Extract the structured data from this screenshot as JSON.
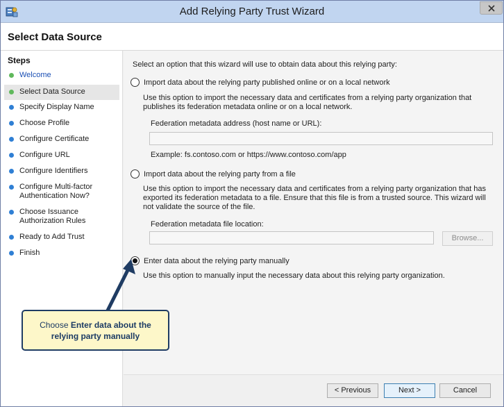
{
  "window": {
    "title": "Add Relying Party Trust Wizard",
    "close_icon": "close-icon",
    "app_icon": "wizard-app-icon"
  },
  "header": {
    "title": "Select Data Source"
  },
  "steps": {
    "heading": "Steps",
    "items": [
      {
        "label": "Welcome",
        "state": "completed-link"
      },
      {
        "label": "Select Data Source",
        "state": "current"
      },
      {
        "label": "Specify Display Name",
        "state": "pending"
      },
      {
        "label": "Choose Profile",
        "state": "pending"
      },
      {
        "label": "Configure Certificate",
        "state": "pending"
      },
      {
        "label": "Configure URL",
        "state": "pending"
      },
      {
        "label": "Configure Identifiers",
        "state": "pending"
      },
      {
        "label": "Configure Multi-factor Authentication Now?",
        "state": "pending"
      },
      {
        "label": "Choose Issuance Authorization Rules",
        "state": "pending"
      },
      {
        "label": "Ready to Add Trust",
        "state": "pending"
      },
      {
        "label": "Finish",
        "state": "pending"
      }
    ]
  },
  "main": {
    "intro": "Select an option that this wizard will use to obtain data about this relying party:",
    "option_online": {
      "label": "Import data about the relying party published online or on a local network",
      "description": "Use this option to import the necessary data and certificates from a relying party organization that publishes its federation metadata online or on a local network.",
      "field_label": "Federation metadata address (host name or URL):",
      "field_value": "",
      "example": "Example: fs.contoso.com or https://www.contoso.com/app",
      "selected": false
    },
    "option_file": {
      "label": "Import data about the relying party from a file",
      "description": "Use this option to import the necessary data and certificates from a relying party organization that has exported its federation metadata to a file. Ensure that this file is from a trusted source.  This wizard will not validate the source of the file.",
      "field_label": "Federation metadata file location:",
      "field_value": "",
      "browse_label": "Browse...",
      "selected": false
    },
    "option_manual": {
      "label": "Enter data about the relying party manually",
      "description": "Use this option to manually input the necessary data about this relying party organization.",
      "selected": true
    }
  },
  "footer": {
    "previous_label": "< Previous",
    "next_label": "Next >",
    "cancel_label": "Cancel"
  },
  "callout": {
    "prefix": "Choose ",
    "emphasis": "Enter data about the relying party manually"
  },
  "colors": {
    "completed_dot": "#5fb85c",
    "pending_dot": "#2f7fd4",
    "link_text": "#1a4fb4",
    "callout_bg": "#fdf7c9",
    "callout_border": "#1f3c63"
  }
}
